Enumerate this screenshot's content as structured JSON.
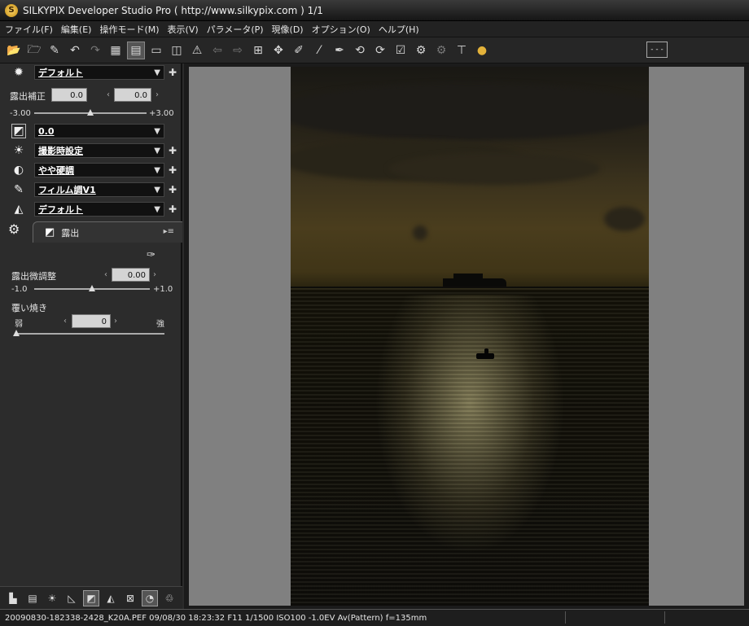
{
  "window": {
    "title": "SILKYPIX Developer Studio Pro ( http://www.silkypix.com )  1/1"
  },
  "menu": [
    "ファイル(F)",
    "編集(E)",
    "操作モード(M)",
    "表示(V)",
    "パラメータ(P)",
    "現像(D)",
    "オプション(O)",
    "ヘルプ(H)"
  ],
  "toolbar": {
    "icons": [
      "folder-open-icon",
      "folder-open-2-icon",
      "satellite-icon",
      "undo-icon",
      "redo-icon",
      "grid-view-icon",
      "combined-view-icon",
      "single-view-icon",
      "compare-view-icon",
      "warning-icon",
      "prev-icon",
      "next-icon",
      "crop-icon",
      "spot-icon",
      "gray-dropper-icon",
      "brush-icon",
      "pen-icon",
      "rotate-left-icon",
      "rotate-right-icon",
      "check-icon",
      "develop-icon",
      "batch-develop-icon",
      "hammer-icon",
      "coin-icon"
    ],
    "monitor_label": "- - -"
  },
  "panel": {
    "taste_select": "デフォルト",
    "exposure": {
      "label": "露出補正",
      "value1": "0.0",
      "value2": "0.0",
      "min": "-3.00",
      "max": "+3.00",
      "level": 0.5
    },
    "tone_select": "0.0",
    "wb_select": "撮影時設定",
    "contrast_select": "やや硬調",
    "color_select": "フィルム調V1",
    "sharp_select": "デフォルト",
    "tab_label": "露出",
    "fine": {
      "label": "露出微調整",
      "value": "0.00",
      "min": "-1.0",
      "max": "+1.0",
      "level": 0.5
    },
    "dodge": {
      "label": "覆い焼き",
      "value": "0",
      "weak": "弱",
      "strong": "強",
      "level": 0.0
    }
  },
  "status": {
    "text": "20090830-182338-2428_K20A.PEF 09/08/30 18:23:32 F11 1/1500 ISO100 -1.0EV Av(Pattern) f=135mm"
  }
}
